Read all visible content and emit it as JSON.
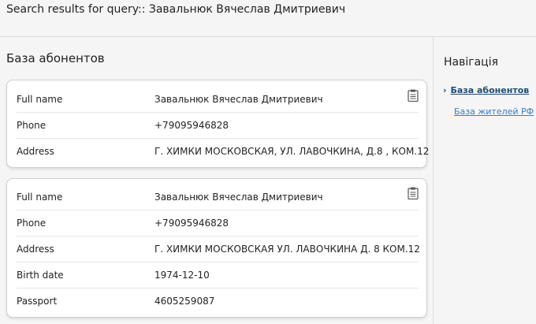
{
  "header": {
    "title": "Search results for query:: Завальнюк Вячеслав Дмитриевич"
  },
  "section": {
    "title": "База абонентов"
  },
  "cards": [
    {
      "rows": [
        {
          "label": "Full name",
          "value": "Завальнюк Вячеслав Дмитриевич"
        },
        {
          "label": "Phone",
          "value": "+79095946828"
        },
        {
          "label": "Address",
          "value": "Г. ХИМКИ МОСКОВСКАЯ, УЛ. ЛАВОЧКИНА, Д.8 , КОМ.12"
        }
      ]
    },
    {
      "rows": [
        {
          "label": "Full name",
          "value": "Завальнюк Вячеслав Дмитриевич"
        },
        {
          "label": "Phone",
          "value": "+79095946828"
        },
        {
          "label": "Address",
          "value": "Г. ХИМКИ МОСКОВСКАЯ УЛ. ЛАВОЧКИНА Д. 8 КОМ.12"
        },
        {
          "label": "Birth date",
          "value": "1974-12-10"
        },
        {
          "label": "Passport",
          "value": "4605259087"
        }
      ]
    }
  ],
  "sidebar": {
    "title": "Навігація",
    "chevron": "›",
    "items": [
      {
        "label": "База абонентов",
        "active": true
      },
      {
        "label": "База жителей РФ",
        "active": false
      }
    ]
  },
  "icons": {
    "copy": "clipboard-icon"
  },
  "colors": {
    "active_link": "#1a4d7a",
    "link": "#3b7dbf"
  }
}
